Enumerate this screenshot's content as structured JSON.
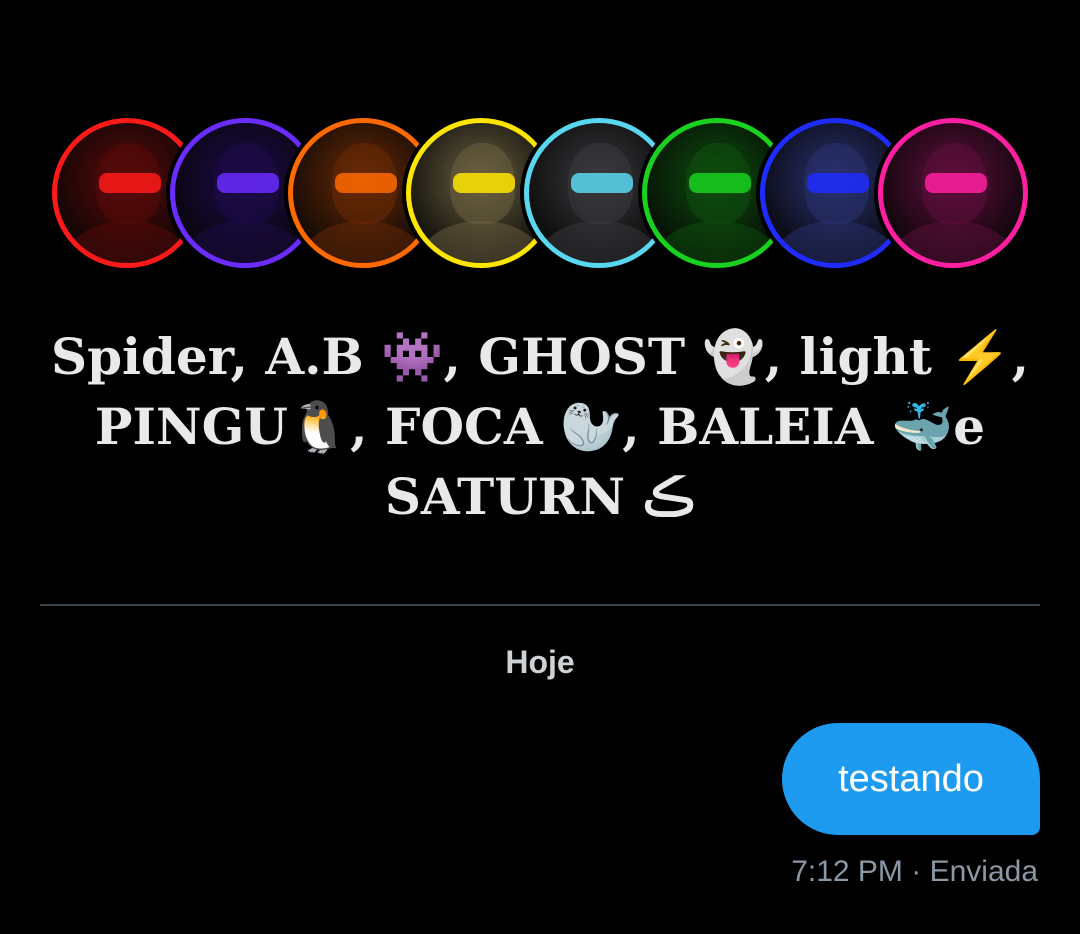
{
  "conversation": {
    "avatars": [
      {
        "name": "avatar-red",
        "color": "#ff1a1a",
        "tone": "#5a0a0a"
      },
      {
        "name": "avatar-purple",
        "color": "#6a2cff",
        "tone": "#1e0b4a"
      },
      {
        "name": "avatar-orange",
        "color": "#ff6a00",
        "tone": "#6a2a06"
      },
      {
        "name": "avatar-yellow",
        "color": "#ffe600",
        "tone": "#6b6040"
      },
      {
        "name": "avatar-cyan",
        "color": "#5ad7f0",
        "tone": "#3a3a3e"
      },
      {
        "name": "avatar-green",
        "color": "#19d11f",
        "tone": "#0e4f0e"
      },
      {
        "name": "avatar-blue",
        "color": "#1f2cff",
        "tone": "#2a3270"
      },
      {
        "name": "avatar-pink",
        "color": "#ff1fa0",
        "tone": "#5e0f3c"
      }
    ],
    "title": "Spider, A.B 👾, GHOST 👻, light ⚡, PINGU🐧, FOCA 🦭, BALEIA 🐳e SATURN⁠ ڪ"
  },
  "messages": {
    "day_label": "Hoje",
    "items": [
      {
        "text": "testando",
        "status": "7:12 PM · Enviada",
        "bubble_color": "#1d9bf0"
      }
    ]
  }
}
